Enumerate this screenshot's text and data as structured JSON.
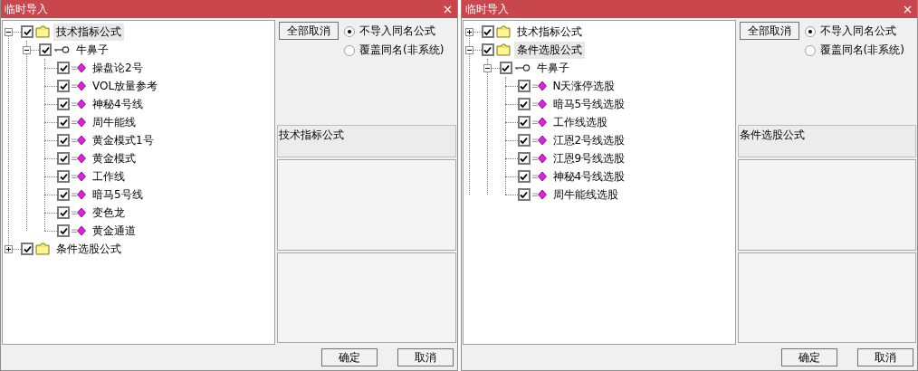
{
  "dialogs": [
    {
      "title": "临时导入",
      "tree": [
        {
          "kind": "folder",
          "label": "技术指标公式",
          "checked": true,
          "expanded": true,
          "selected": true,
          "children": [
            {
              "kind": "group",
              "label": "牛鼻子",
              "checked": true,
              "expanded": true,
              "selected": false,
              "children": [
                {
                  "kind": "formula",
                  "label": "操盘论2号",
                  "checked": true,
                  "selected": false
                },
                {
                  "kind": "formula",
                  "label": "VOL放量参考",
                  "checked": true,
                  "selected": false
                },
                {
                  "kind": "formula",
                  "label": "神秘4号线",
                  "checked": true,
                  "selected": false
                },
                {
                  "kind": "formula",
                  "label": "周牛能线",
                  "checked": true,
                  "selected": false
                },
                {
                  "kind": "formula",
                  "label": "黄金模式1号",
                  "checked": true,
                  "selected": false
                },
                {
                  "kind": "formula",
                  "label": "黄金模式",
                  "checked": true,
                  "selected": false
                },
                {
                  "kind": "formula",
                  "label": "工作线",
                  "checked": true,
                  "selected": false
                },
                {
                  "kind": "formula",
                  "label": "暗马5号线",
                  "checked": true,
                  "selected": false
                },
                {
                  "kind": "formula",
                  "label": "变色龙",
                  "checked": true,
                  "selected": false
                },
                {
                  "kind": "formula",
                  "label": "黄金通道",
                  "checked": true,
                  "selected": false
                }
              ]
            }
          ]
        },
        {
          "kind": "folder",
          "label": "条件选股公式",
          "checked": true,
          "expanded": false,
          "selected": false
        }
      ],
      "cancel_all": "全部取消",
      "radios": [
        {
          "label": "不导入同名公式",
          "selected": true
        },
        {
          "label": "覆盖同名(非系统)",
          "selected": false
        }
      ],
      "info": "技术指标公式",
      "buttons": [
        "确定",
        "取消"
      ]
    },
    {
      "title": "临时导入",
      "tree": [
        {
          "kind": "folder",
          "label": "技术指标公式",
          "checked": true,
          "expanded": false,
          "selected": false
        },
        {
          "kind": "folder",
          "label": "条件选股公式",
          "checked": true,
          "expanded": true,
          "selected": true,
          "children": [
            {
              "kind": "group",
              "label": "牛鼻子",
              "checked": true,
              "expanded": true,
              "selected": false,
              "children": [
                {
                  "kind": "formula",
                  "label": "N天涨停选股",
                  "checked": true,
                  "selected": false
                },
                {
                  "kind": "formula",
                  "label": "暗马5号线选股",
                  "checked": true,
                  "selected": false
                },
                {
                  "kind": "formula",
                  "label": "工作线选股",
                  "checked": true,
                  "selected": false
                },
                {
                  "kind": "formula",
                  "label": "江恩2号线选股",
                  "checked": true,
                  "selected": false
                },
                {
                  "kind": "formula",
                  "label": "江恩9号线选股",
                  "checked": true,
                  "selected": false
                },
                {
                  "kind": "formula",
                  "label": "神秘4号线选股",
                  "checked": true,
                  "selected": false
                },
                {
                  "kind": "formula",
                  "label": "周牛能线选股",
                  "checked": true,
                  "selected": false
                }
              ]
            }
          ]
        }
      ],
      "cancel_all": "全部取消",
      "radios": [
        {
          "label": "不导入同名公式",
          "selected": true
        },
        {
          "label": "覆盖同名(非系统)",
          "selected": false
        }
      ],
      "info": "条件选股公式",
      "buttons": [
        "确定",
        "取消"
      ]
    }
  ]
}
